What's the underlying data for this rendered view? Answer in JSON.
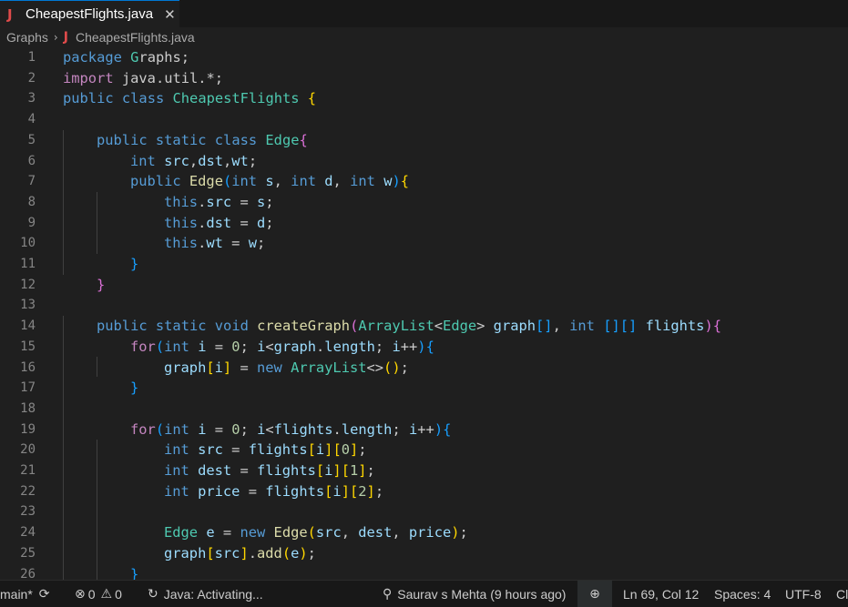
{
  "tab": {
    "label": "CheapestFlights.java",
    "file_icon": "J",
    "close_glyph": "✕"
  },
  "breadcrumb": {
    "folder": "Graphs",
    "chevron": "›",
    "file_icon": "J",
    "file": "CheapestFlights.java"
  },
  "editor": {
    "lines": [
      {
        "n": "1",
        "tokens": [
          [
            "kw",
            "package"
          ],
          [
            "",
            " "
          ],
          [
            "ty",
            "G"
          ],
          [
            "",
            "raphs;"
          ]
        ]
      },
      {
        "n": "2",
        "tokens": [
          [
            "ctl",
            "import"
          ],
          [
            "",
            " java.util.*;"
          ]
        ]
      },
      {
        "n": "3",
        "tokens": [
          [
            "kw",
            "public"
          ],
          [
            "",
            " "
          ],
          [
            "kw",
            "class"
          ],
          [
            "",
            " "
          ],
          [
            "ty",
            "CheapestFlights"
          ],
          [
            "",
            " "
          ],
          [
            "br1",
            "{"
          ]
        ]
      },
      {
        "n": "4",
        "tokens": []
      },
      {
        "n": "5",
        "tokens": [
          [
            "",
            "    "
          ],
          [
            "kw",
            "public"
          ],
          [
            "",
            " "
          ],
          [
            "kw",
            "static"
          ],
          [
            "",
            " "
          ],
          [
            "kw",
            "class"
          ],
          [
            "",
            " "
          ],
          [
            "ty",
            "Edge"
          ],
          [
            "br2",
            "{"
          ]
        ]
      },
      {
        "n": "6",
        "tokens": [
          [
            "",
            "        "
          ],
          [
            "kw",
            "int"
          ],
          [
            "",
            " "
          ],
          [
            "vr",
            "src"
          ],
          [
            "",
            ","
          ],
          [
            "vr",
            "dst"
          ],
          [
            "",
            ","
          ],
          [
            "vr",
            "wt"
          ],
          [
            "",
            ";"
          ]
        ]
      },
      {
        "n": "7",
        "tokens": [
          [
            "",
            "        "
          ],
          [
            "kw",
            "public"
          ],
          [
            "",
            " "
          ],
          [
            "fn",
            "Edge"
          ],
          [
            "br3",
            "("
          ],
          [
            "kw",
            "int"
          ],
          [
            "",
            " "
          ],
          [
            "vr",
            "s"
          ],
          [
            "",
            ", "
          ],
          [
            "kw",
            "int"
          ],
          [
            "",
            " "
          ],
          [
            "vr",
            "d"
          ],
          [
            "",
            ", "
          ],
          [
            "kw",
            "int"
          ],
          [
            "",
            " "
          ],
          [
            "vr",
            "w"
          ],
          [
            "br3",
            ")"
          ],
          [
            "br1",
            "{"
          ]
        ]
      },
      {
        "n": "8",
        "tokens": [
          [
            "",
            "            "
          ],
          [
            "kw",
            "this"
          ],
          [
            "",
            "."
          ],
          [
            "vr",
            "src"
          ],
          [
            "",
            " = "
          ],
          [
            "vr",
            "s"
          ],
          [
            "",
            ";"
          ]
        ]
      },
      {
        "n": "9",
        "tokens": [
          [
            "",
            "            "
          ],
          [
            "kw",
            "this"
          ],
          [
            "",
            "."
          ],
          [
            "vr",
            "dst"
          ],
          [
            "",
            " = "
          ],
          [
            "vr",
            "d"
          ],
          [
            "",
            ";"
          ]
        ]
      },
      {
        "n": "10",
        "tokens": [
          [
            "",
            "            "
          ],
          [
            "kw",
            "this"
          ],
          [
            "",
            "."
          ],
          [
            "vr",
            "wt"
          ],
          [
            "",
            " = "
          ],
          [
            "vr",
            "w"
          ],
          [
            "",
            ";"
          ]
        ]
      },
      {
        "n": "11",
        "tokens": [
          [
            "",
            "        "
          ],
          [
            "br3",
            "}"
          ]
        ]
      },
      {
        "n": "12",
        "tokens": [
          [
            "",
            "    "
          ],
          [
            "br2",
            "}"
          ]
        ]
      },
      {
        "n": "13",
        "tokens": []
      },
      {
        "n": "14",
        "tokens": [
          [
            "",
            "    "
          ],
          [
            "kw",
            "public"
          ],
          [
            "",
            " "
          ],
          [
            "kw",
            "static"
          ],
          [
            "",
            " "
          ],
          [
            "kw",
            "void"
          ],
          [
            "",
            " "
          ],
          [
            "fn",
            "createGraph"
          ],
          [
            "br2",
            "("
          ],
          [
            "ty",
            "ArrayList"
          ],
          [
            "",
            "<"
          ],
          [
            "ty",
            "Edge"
          ],
          [
            "",
            "> "
          ],
          [
            "vr",
            "graph"
          ],
          [
            "br3",
            "[]"
          ],
          [
            "",
            ", "
          ],
          [
            "kw",
            "int"
          ],
          [
            "",
            " "
          ],
          [
            "br3",
            "[][]"
          ],
          [
            "",
            " "
          ],
          [
            "vr",
            "flights"
          ],
          [
            "br2",
            ")"
          ],
          [
            "br2",
            "{"
          ]
        ]
      },
      {
        "n": "15",
        "tokens": [
          [
            "",
            "        "
          ],
          [
            "ctl",
            "for"
          ],
          [
            "br3",
            "("
          ],
          [
            "kw",
            "int"
          ],
          [
            "",
            " "
          ],
          [
            "vr",
            "i"
          ],
          [
            "",
            " = "
          ],
          [
            "nm",
            "0"
          ],
          [
            "",
            "; "
          ],
          [
            "vr",
            "i"
          ],
          [
            "",
            "<"
          ],
          [
            "vr",
            "graph"
          ],
          [
            "",
            "."
          ],
          [
            "vr",
            "length"
          ],
          [
            "",
            "; "
          ],
          [
            "vr",
            "i"
          ],
          [
            "",
            "++"
          ],
          [
            "br3",
            ")"
          ],
          [
            "br3",
            "{"
          ]
        ]
      },
      {
        "n": "16",
        "tokens": [
          [
            "",
            "            "
          ],
          [
            "vr",
            "graph"
          ],
          [
            "br1",
            "["
          ],
          [
            "vr",
            "i"
          ],
          [
            "br1",
            "]"
          ],
          [
            "",
            " = "
          ],
          [
            "kw",
            "new"
          ],
          [
            "",
            " "
          ],
          [
            "ty",
            "ArrayList"
          ],
          [
            "",
            "<>"
          ],
          [
            "br1",
            "()"
          ],
          [
            "",
            ";"
          ]
        ]
      },
      {
        "n": "17",
        "tokens": [
          [
            "",
            "        "
          ],
          [
            "br3",
            "}"
          ]
        ]
      },
      {
        "n": "18",
        "tokens": []
      },
      {
        "n": "19",
        "tokens": [
          [
            "",
            "        "
          ],
          [
            "ctl",
            "for"
          ],
          [
            "br3",
            "("
          ],
          [
            "kw",
            "int"
          ],
          [
            "",
            " "
          ],
          [
            "vr",
            "i"
          ],
          [
            "",
            " = "
          ],
          [
            "nm",
            "0"
          ],
          [
            "",
            "; "
          ],
          [
            "vr",
            "i"
          ],
          [
            "",
            "<"
          ],
          [
            "vr",
            "flights"
          ],
          [
            "",
            "."
          ],
          [
            "vr",
            "length"
          ],
          [
            "",
            "; "
          ],
          [
            "vr",
            "i"
          ],
          [
            "",
            "++"
          ],
          [
            "br3",
            ")"
          ],
          [
            "br3",
            "{"
          ]
        ]
      },
      {
        "n": "20",
        "tokens": [
          [
            "",
            "            "
          ],
          [
            "kw",
            "int"
          ],
          [
            "",
            " "
          ],
          [
            "vr",
            "src"
          ],
          [
            "",
            " = "
          ],
          [
            "vr",
            "flights"
          ],
          [
            "br1",
            "["
          ],
          [
            "vr",
            "i"
          ],
          [
            "br1",
            "]"
          ],
          [
            "br1",
            "["
          ],
          [
            "nm",
            "0"
          ],
          [
            "br1",
            "]"
          ],
          [
            "",
            ";"
          ]
        ]
      },
      {
        "n": "21",
        "tokens": [
          [
            "",
            "            "
          ],
          [
            "kw",
            "int"
          ],
          [
            "",
            " "
          ],
          [
            "vr",
            "dest"
          ],
          [
            "",
            " = "
          ],
          [
            "vr",
            "flights"
          ],
          [
            "br1",
            "["
          ],
          [
            "vr",
            "i"
          ],
          [
            "br1",
            "]"
          ],
          [
            "br1",
            "["
          ],
          [
            "nm",
            "1"
          ],
          [
            "br1",
            "]"
          ],
          [
            "",
            ";"
          ]
        ]
      },
      {
        "n": "22",
        "tokens": [
          [
            "",
            "            "
          ],
          [
            "kw",
            "int"
          ],
          [
            "",
            " "
          ],
          [
            "vr",
            "price"
          ],
          [
            "",
            " = "
          ],
          [
            "vr",
            "flights"
          ],
          [
            "br1",
            "["
          ],
          [
            "vr",
            "i"
          ],
          [
            "br1",
            "]"
          ],
          [
            "br1",
            "["
          ],
          [
            "nm",
            "2"
          ],
          [
            "br1",
            "]"
          ],
          [
            "",
            ";"
          ]
        ]
      },
      {
        "n": "23",
        "tokens": []
      },
      {
        "n": "24",
        "tokens": [
          [
            "",
            "            "
          ],
          [
            "ty",
            "Edge"
          ],
          [
            "",
            " "
          ],
          [
            "vr",
            "e"
          ],
          [
            "",
            " = "
          ],
          [
            "kw",
            "new"
          ],
          [
            "",
            " "
          ],
          [
            "fn",
            "Edge"
          ],
          [
            "br1",
            "("
          ],
          [
            "vr",
            "src"
          ],
          [
            "",
            ", "
          ],
          [
            "vr",
            "dest"
          ],
          [
            "",
            ", "
          ],
          [
            "vr",
            "price"
          ],
          [
            "br1",
            ")"
          ],
          [
            "",
            ";"
          ]
        ]
      },
      {
        "n": "25",
        "tokens": [
          [
            "",
            "            "
          ],
          [
            "vr",
            "graph"
          ],
          [
            "br1",
            "["
          ],
          [
            "vr",
            "src"
          ],
          [
            "br1",
            "]"
          ],
          [
            "",
            "."
          ],
          [
            "fn",
            "add"
          ],
          [
            "br1",
            "("
          ],
          [
            "vr",
            "e"
          ],
          [
            "br1",
            ")"
          ],
          [
            "",
            ";"
          ]
        ]
      },
      {
        "n": "26",
        "tokens": [
          [
            "",
            "        "
          ],
          [
            "br3",
            "}"
          ]
        ]
      }
    ]
  },
  "statusbar": {
    "branch": "main*",
    "errors": "0",
    "warnings": "0",
    "java_status": "Java: Activating...",
    "blame": "Saurav s Mehta (9 hours ago)",
    "cursor": "Ln 69, Col 12",
    "spaces": "Spaces: 4",
    "encoding": "UTF-8",
    "eol": "Cl"
  },
  "icons": {
    "sync": "sync-icon",
    "error": "error-icon",
    "warning": "warning-icon",
    "loading": "loading-icon",
    "person": "git-commit-icon",
    "zoom": "zoom-icon"
  },
  "colors": {
    "accent": "#0078d4",
    "keyword": "#569cd6",
    "type": "#4ec9b0",
    "function": "#dcdcaa",
    "variable": "#9cdcfe"
  }
}
